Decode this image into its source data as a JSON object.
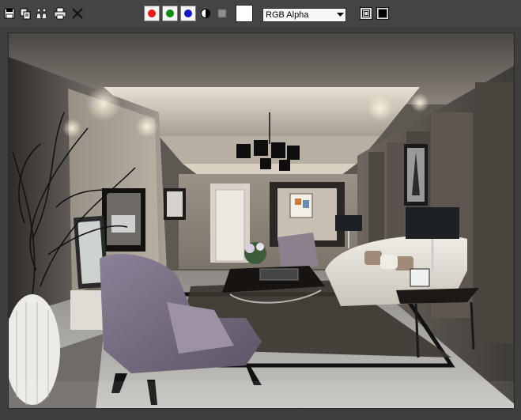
{
  "toolbar": {
    "tools": [
      {
        "id": "save",
        "icon": "save-icon"
      },
      {
        "id": "clone",
        "icon": "clone-icon"
      },
      {
        "id": "sequence",
        "icon": "people-icon"
      },
      {
        "id": "print",
        "icon": "print-icon"
      },
      {
        "id": "clear",
        "icon": "close-icon"
      }
    ],
    "channels": [
      {
        "id": "red",
        "color": "#e81a1a"
      },
      {
        "id": "green",
        "color": "#128a12"
      },
      {
        "id": "blue",
        "color": "#1616c8"
      }
    ],
    "mono_icon": "half-circle-icon",
    "stop_icon": "square-icon",
    "swatch_color": "#ffffff",
    "channel_select": {
      "value": "RGB Alpha"
    },
    "display_toggle_icons": [
      "frame-icon",
      "window-icon"
    ]
  },
  "viewport": {
    "content": "rendered-interior-image"
  }
}
